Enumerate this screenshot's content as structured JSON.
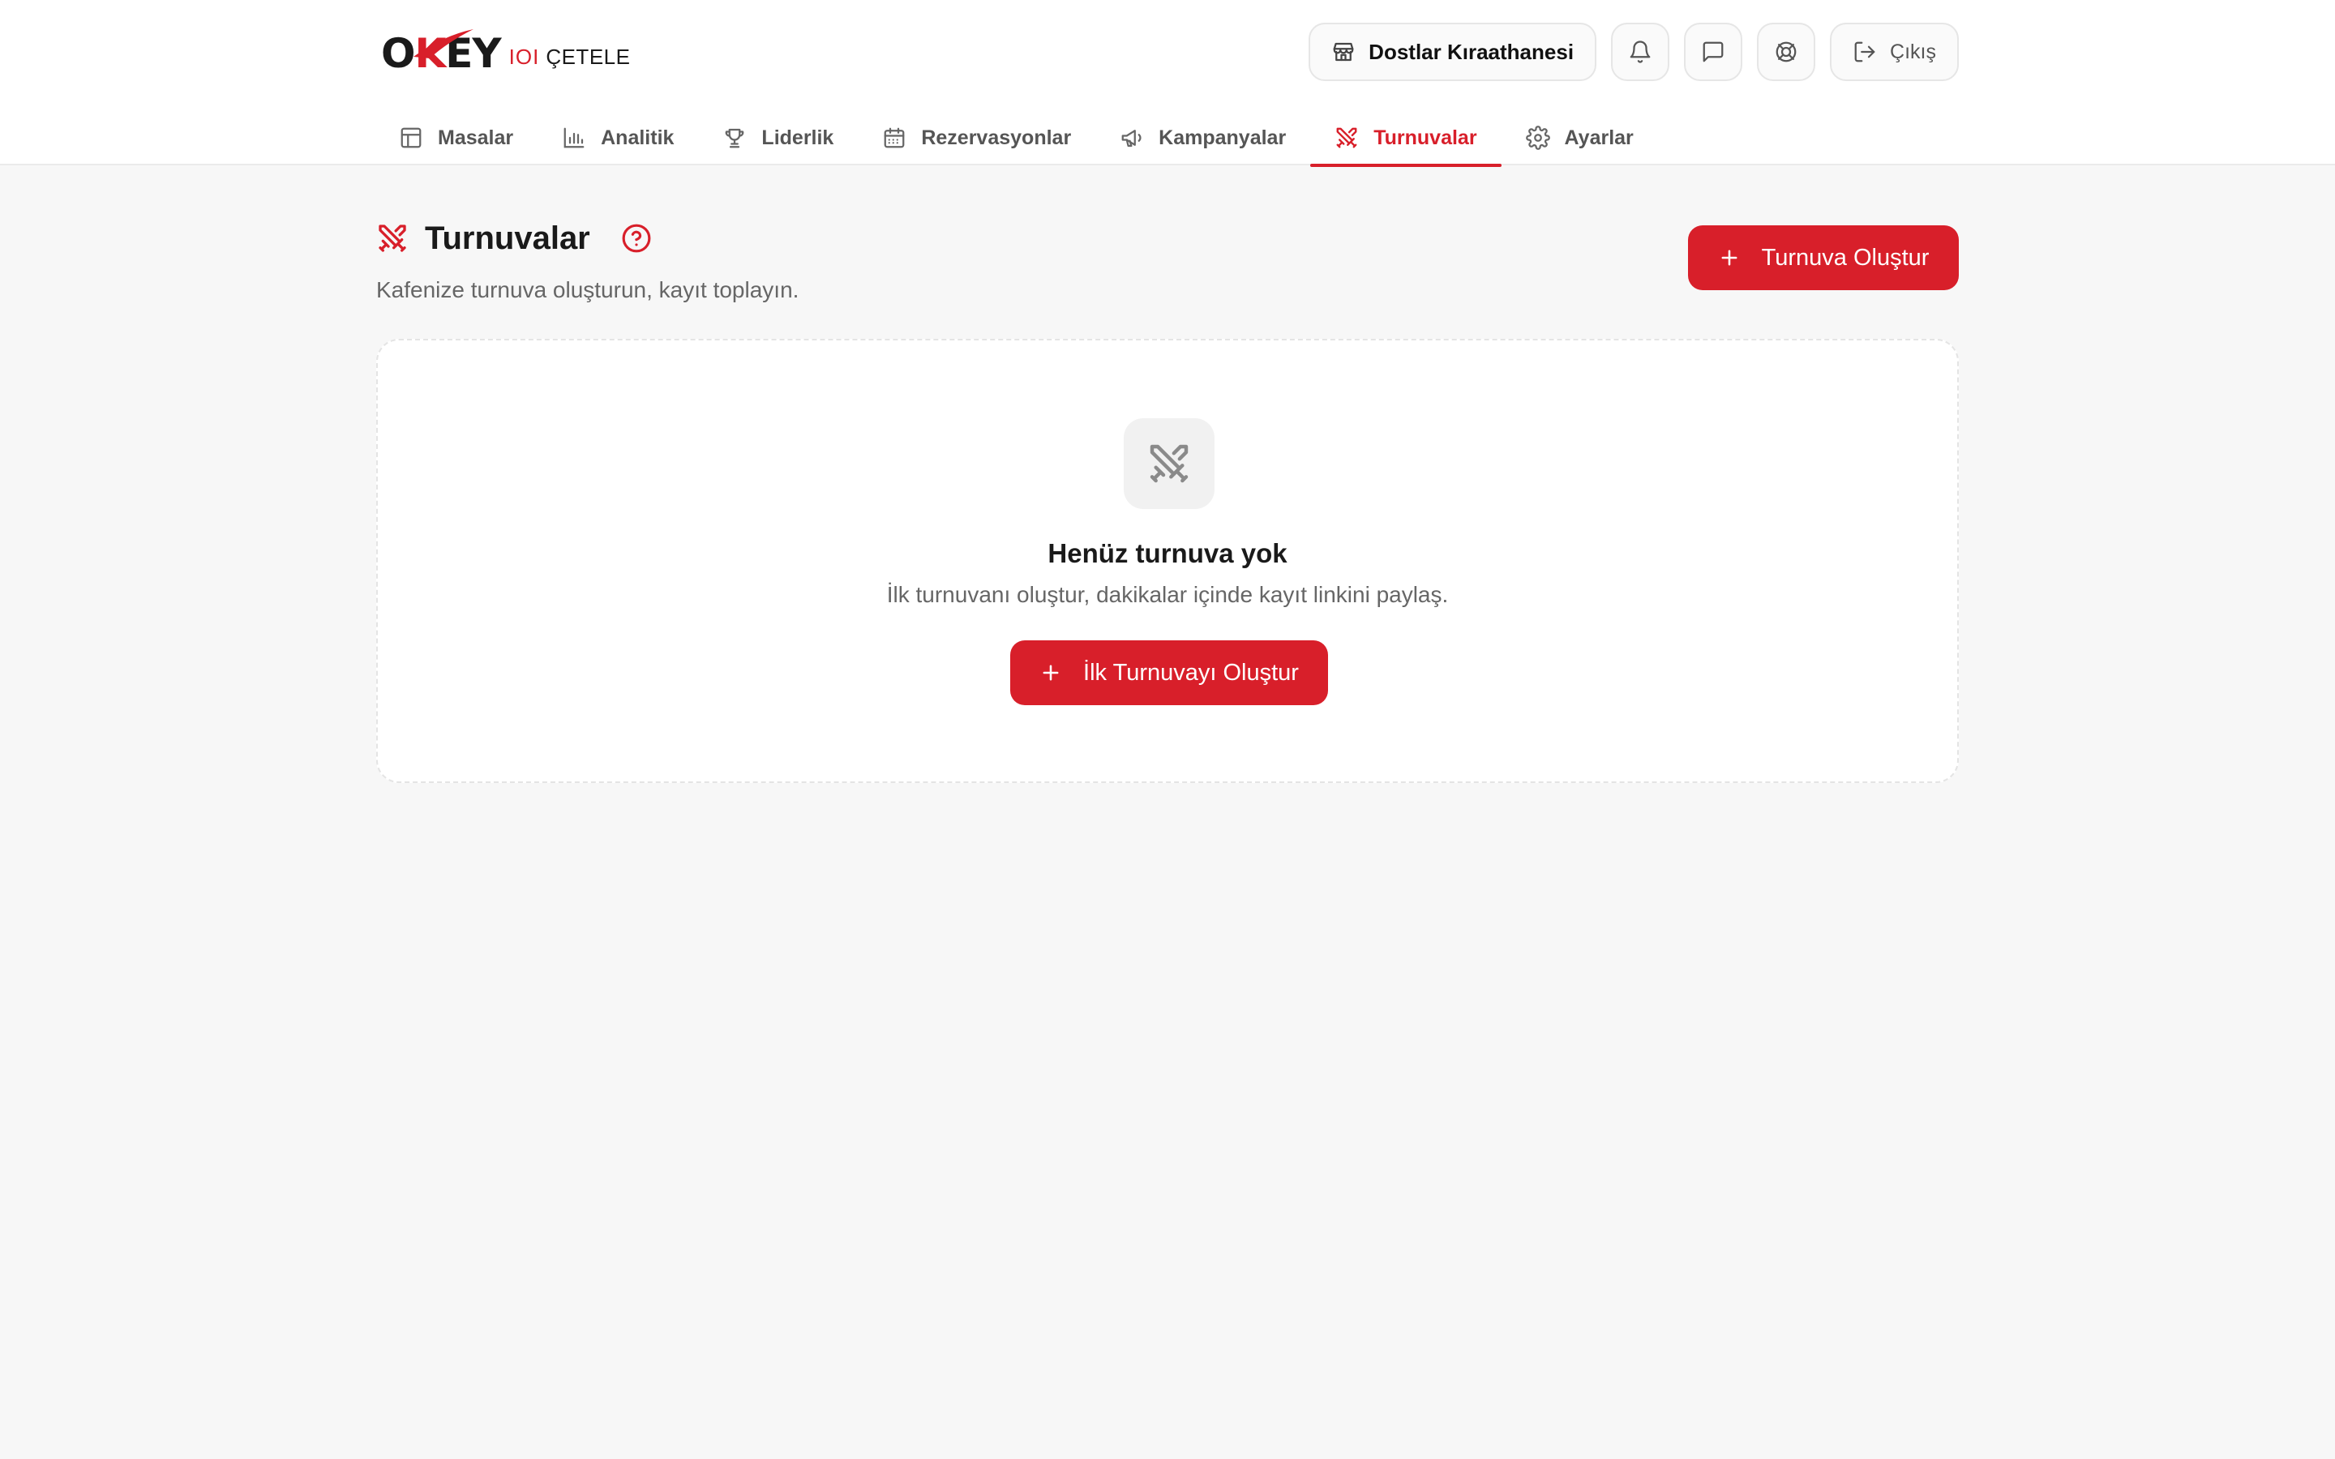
{
  "brand": {
    "logo_main_left": "O",
    "logo_main_k": "K",
    "logo_main_right": "EY",
    "logo_ioi": "IOI",
    "logo_sub": "ÇETELE"
  },
  "top_bar": {
    "venue_name": "Dostlar Kıraathanesi",
    "logout_label": "Çıkış"
  },
  "nav": {
    "items": [
      {
        "label": "Masalar",
        "icon": "table-icon"
      },
      {
        "label": "Analitik",
        "icon": "bar-chart-icon"
      },
      {
        "label": "Liderlik",
        "icon": "trophy-icon"
      },
      {
        "label": "Rezervasyonlar",
        "icon": "calendar-icon"
      },
      {
        "label": "Kampanyalar",
        "icon": "megaphone-icon"
      },
      {
        "label": "Turnuvalar",
        "icon": "swords-icon",
        "active": true
      },
      {
        "label": "Ayarlar",
        "icon": "gear-icon"
      }
    ]
  },
  "page": {
    "title": "Turnuvalar",
    "subtitle": "Kafenize turnuva oluşturun, kayıt toplayın.",
    "create_button": "Turnuva Oluştur"
  },
  "empty_state": {
    "title": "Henüz turnuva yok",
    "description": "İlk turnuvanı oluştur, dakikalar içinde kayıt linkini paylaş.",
    "button": "İlk Turnuvayı Oluştur"
  },
  "colors": {
    "accent": "#d81f2a",
    "background": "#f7f7f7",
    "card": "#ffffff",
    "muted_text": "#666666"
  }
}
